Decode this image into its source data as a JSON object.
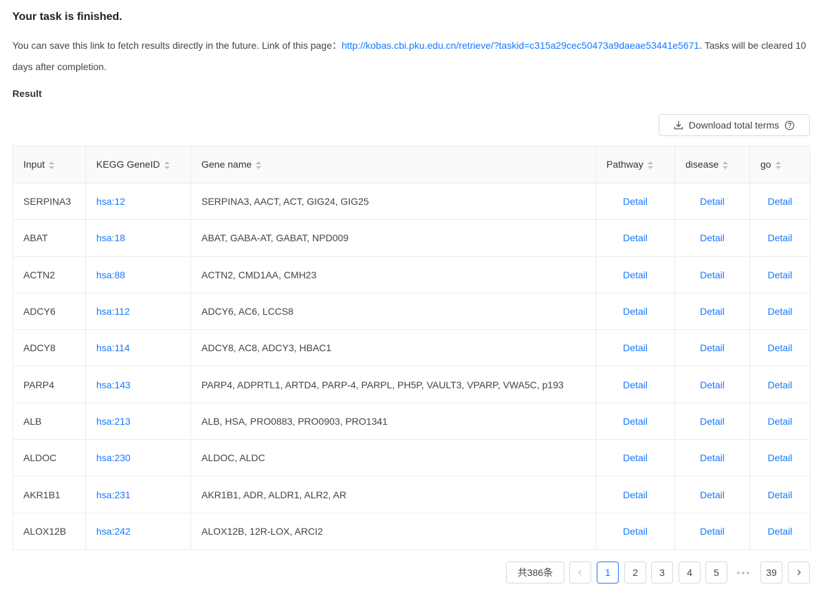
{
  "header": {
    "title": "Your task is finished.",
    "desc_prefix": "You can save this link to fetch results directly in the future. Link of this page：",
    "link": "http://kobas.cbi.pku.edu.cn/retrieve/?taskid=c315a29cec50473a9daeae53441e5671",
    "desc_suffix": ". Tasks will be cleared 10 days after completion."
  },
  "result_label": "Result",
  "download_button": {
    "label": "Download total terms",
    "icon": "download-icon",
    "help_icon": "question-circle-icon"
  },
  "table": {
    "columns": [
      "Input",
      "KEGG GeneID",
      "Gene name",
      "Pathway",
      "disease",
      "go"
    ],
    "detail_label": "Detail",
    "rows": [
      {
        "input": "SERPINA3",
        "gene_id": "hsa:12",
        "gene_name": "SERPINA3, AACT, ACT, GIG24, GIG25"
      },
      {
        "input": "ABAT",
        "gene_id": "hsa:18",
        "gene_name": "ABAT, GABA-AT, GABAT, NPD009"
      },
      {
        "input": "ACTN2",
        "gene_id": "hsa:88",
        "gene_name": "ACTN2, CMD1AA, CMH23"
      },
      {
        "input": "ADCY6",
        "gene_id": "hsa:112",
        "gene_name": "ADCY6, AC6, LCCS8"
      },
      {
        "input": "ADCY8",
        "gene_id": "hsa:114",
        "gene_name": "ADCY8, AC8, ADCY3, HBAC1"
      },
      {
        "input": "PARP4",
        "gene_id": "hsa:143",
        "gene_name": "PARP4, ADPRTL1, ARTD4, PARP-4, PARPL, PH5P, VAULT3, VPARP, VWA5C, p193"
      },
      {
        "input": "ALB",
        "gene_id": "hsa:213",
        "gene_name": "ALB, HSA, PRO0883, PRO0903, PRO1341"
      },
      {
        "input": "ALDOC",
        "gene_id": "hsa:230",
        "gene_name": "ALDOC, ALDC"
      },
      {
        "input": "AKR1B1",
        "gene_id": "hsa:231",
        "gene_name": "AKR1B1, ADR, ALDR1, ALR2, AR"
      },
      {
        "input": "ALOX12B",
        "gene_id": "hsa:242",
        "gene_name": "ALOX12B, 12R-LOX, ARCI2"
      }
    ]
  },
  "pagination": {
    "total": "共386条",
    "pages": [
      "1",
      "2",
      "3",
      "4",
      "5"
    ],
    "ellipsis": "•••",
    "last": "39",
    "current": "1"
  },
  "colors": {
    "link": "#1677ff",
    "border": "#d9d9d9",
    "header_bg": "#fafafa"
  }
}
